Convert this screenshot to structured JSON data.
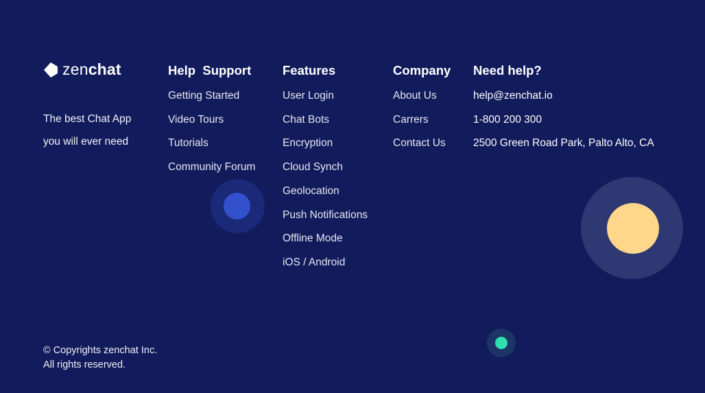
{
  "brand": {
    "name_part1": "zen",
    "name_part2": "chat",
    "tagline_line1": "The best Chat App",
    "tagline_line2": "you will ever need"
  },
  "columns": {
    "help": {
      "title": "Help  Support",
      "items": [
        "Getting Started",
        "Video Tours",
        "Tutorials",
        "Community Forum"
      ]
    },
    "features": {
      "title": "Features",
      "items": [
        "User Login",
        "Chat Bots",
        "Encryption",
        "Cloud Synch",
        "Geolocation",
        "Push Notifications",
        "Offline Mode",
        "iOS / Android"
      ]
    },
    "company": {
      "title": "Company",
      "items": [
        "About Us",
        "Carrers",
        "Contact Us"
      ]
    },
    "contact": {
      "title": "Need help?",
      "email": "help@zenchat.io",
      "phone": "1-800 200 300",
      "address": "2500 Green Road Park, Palto Alto, CA"
    }
  },
  "footer": {
    "copyright_line1": "© Copyrights zenchat Inc.",
    "copyright_line2": "All rights reserved."
  },
  "colors": {
    "background": "#121b5b",
    "accent_blue": "#3351cc",
    "accent_yellow": "#ffd78a",
    "accent_green": "#2ee0b0"
  }
}
